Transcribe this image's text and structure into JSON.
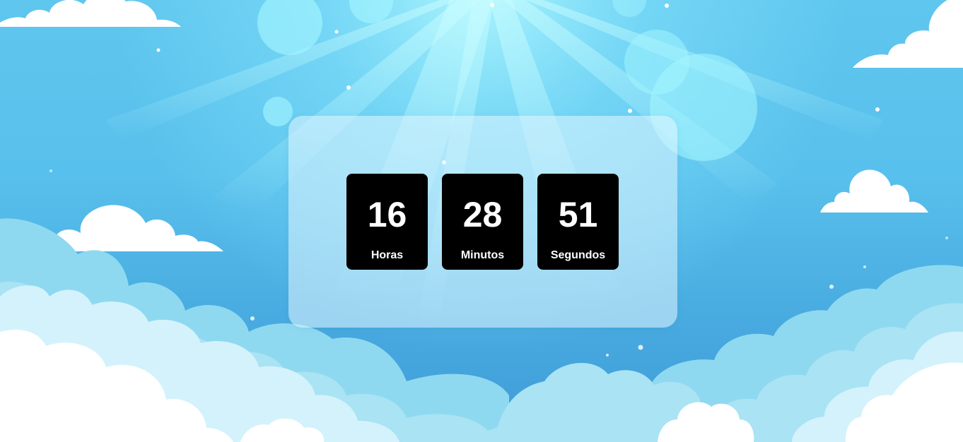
{
  "countdown": {
    "hours": {
      "value": "16",
      "label": "Horas"
    },
    "minutes": {
      "value": "28",
      "label": "Minutos"
    },
    "seconds": {
      "value": "51",
      "label": "Segundos"
    }
  },
  "colors": {
    "sky_top": "#5fc6ee",
    "sky_bottom": "#3f9bd8",
    "tile_background": "#000000",
    "tile_text": "#ffffff",
    "cloud": "#ffffff"
  },
  "decorations": {
    "icons": [
      "sun-rays",
      "bokeh-circles",
      "cloud",
      "sparkle-dots"
    ]
  }
}
